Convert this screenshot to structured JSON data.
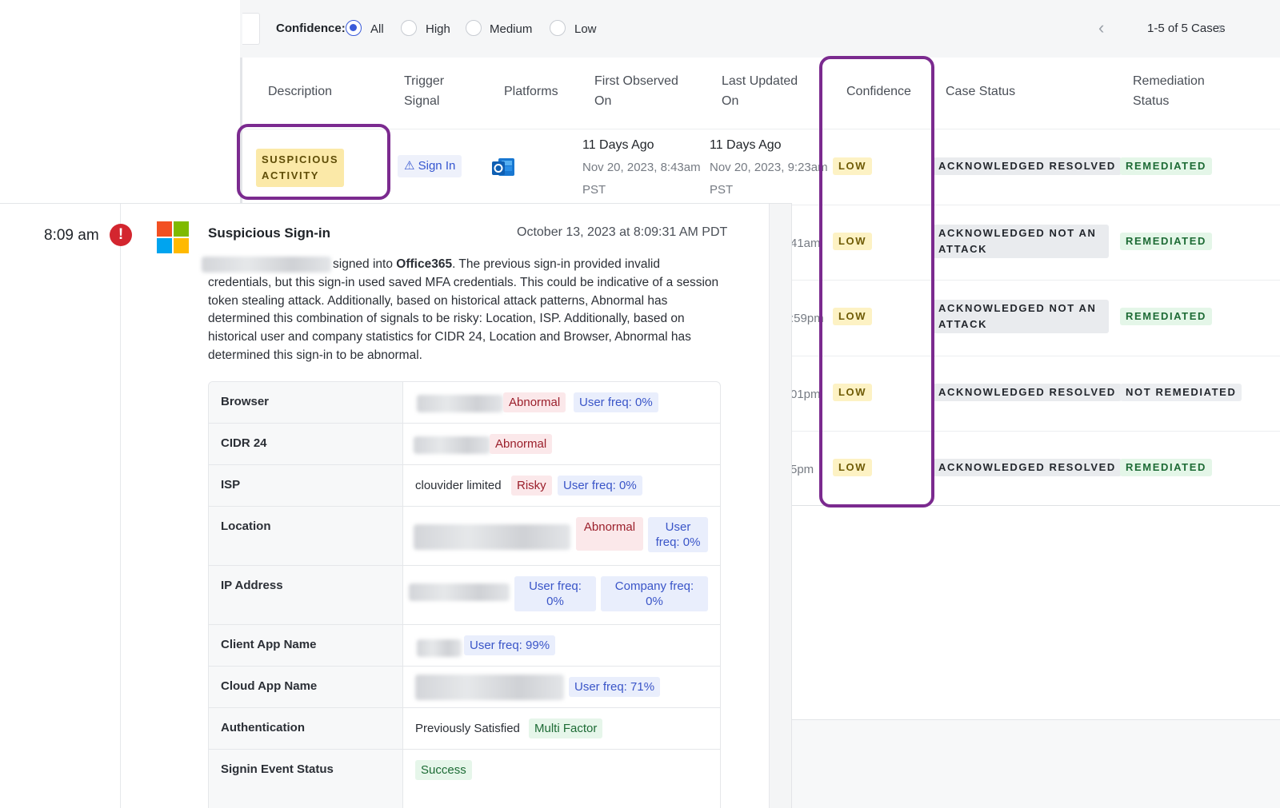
{
  "filter": {
    "label": "Confidence",
    "colon": ":",
    "options": [
      "All",
      "High",
      "Medium",
      "Low"
    ],
    "selected": "All"
  },
  "pager": {
    "text": "1-5 of 5 Cases",
    "prev_icon": "chevron-left",
    "next_icon": "chevron-right"
  },
  "table": {
    "headers": {
      "description": "Description",
      "trigger_1": "Trigger",
      "trigger_2": "Signal",
      "platforms": "Platforms",
      "first_1": "First Observed",
      "first_2": "On",
      "last_1": "Last Updated",
      "last_2": "On",
      "confidence": "Confidence",
      "case_status": "Case Status",
      "rem_1": "Remediation",
      "rem_2": "Status"
    },
    "row1": {
      "description_1": "SUSPICIOUS",
      "description_2": "ACTIVITY",
      "trigger": "Sign In",
      "trigger_icon": "warning-triangle",
      "platform_icon": "outlook-icon",
      "first_main": "11 Days Ago",
      "first_date": "Nov 20, 2023, 8:43am",
      "first_tz": "PST",
      "last_main": "11 Days Ago",
      "last_date": "Nov 20, 2023, 9:23am",
      "last_tz": "PST"
    },
    "clipped_times": [
      "41am",
      ":59pm",
      "01pm",
      "5pm"
    ],
    "rows": [
      {
        "confidence": "LOW",
        "case_status_1": "ACKNOWLEDGED RESOLVED",
        "case_status_2": "",
        "remediation": "REMEDIATED"
      },
      {
        "confidence": "LOW",
        "case_status_1": "ACKNOWLEDGED NOT AN",
        "case_status_2": "ATTACK",
        "remediation": "REMEDIATED"
      },
      {
        "confidence": "LOW",
        "case_status_1": "ACKNOWLEDGED NOT AN",
        "case_status_2": "ATTACK",
        "remediation": "REMEDIATED"
      },
      {
        "confidence": "LOW",
        "case_status_1": "ACKNOWLEDGED RESOLVED",
        "case_status_2": "",
        "remediation": "NOT REMEDIATED"
      },
      {
        "confidence": "LOW",
        "case_status_1": "ACKNOWLEDGED RESOLVED",
        "case_status_2": "",
        "remediation": "REMEDIATED"
      }
    ]
  },
  "event": {
    "time": "8:09 am",
    "alert_icon": "!",
    "title": "Suspicious Sign-in",
    "timestamp": "October 13, 2023 at 8:09:31 AM PDT",
    "desc_lead": "signed into ",
    "desc_app": "Office365",
    "desc_rest": ". The previous sign-in provided invalid credentials, but this sign-in used saved MFA credentials. This could be indicative of a session token stealing attack. Additionally, based on historical attack patterns, Abnormal has determined this combination of signals to be risky: Location, ISP. Additionally, based on historical user and company statistics for CIDR 24, Location and Browser, Abnormal has determined this sign-in to be abnormal.",
    "details": {
      "browser": {
        "label": "Browser",
        "tag": "Abnormal",
        "freq": "User freq: 0%"
      },
      "cidr": {
        "label": "CIDR 24",
        "tag": "Abnormal"
      },
      "isp": {
        "label": "ISP",
        "value": "clouvider limited",
        "tag": "Risky",
        "freq": "User freq: 0%"
      },
      "location": {
        "label": "Location",
        "tag": "Abnormal",
        "freq_1": "User",
        "freq_2": "freq: 0%"
      },
      "ip": {
        "label": "IP Address",
        "user_freq_1": "User freq:",
        "user_freq_2": "0%",
        "company_freq_1": "Company freq:",
        "company_freq_2": "0%"
      },
      "client_app": {
        "label": "Client App Name",
        "freq": "User freq: 99%"
      },
      "cloud_app": {
        "label": "Cloud App Name",
        "freq": "User freq: 71%"
      },
      "auth": {
        "label": "Authentication",
        "value": "Previously Satisfied",
        "tag": "Multi Factor"
      },
      "status": {
        "label": "Signin Event Status",
        "tag": "Success"
      }
    }
  },
  "colors": {
    "highlight": "#7b2a8f",
    "radio_selected": "#3a5bd9",
    "alert": "#d3262f",
    "ms_red": "#f25022",
    "ms_green": "#7fba00",
    "ms_blue": "#00a4ef",
    "ms_yellow": "#ffb900"
  }
}
